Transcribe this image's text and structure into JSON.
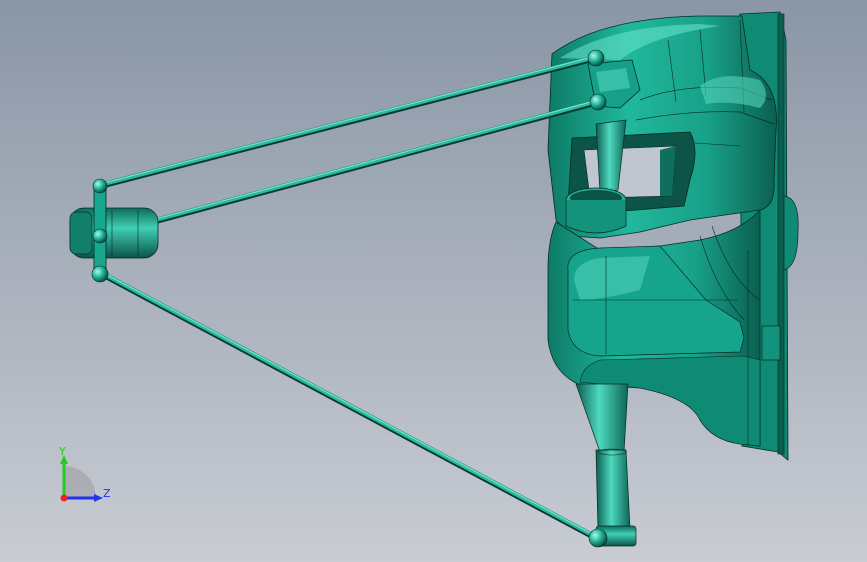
{
  "viewport": {
    "bg_top": "#8a96a6",
    "bg_bottom": "#c9ccd3"
  },
  "model": {
    "body_color": "#1aa68e",
    "body_dark": "#0c6b5a",
    "body_light": "#5fe0c8",
    "edge_color": "#052b24",
    "rod_color": "#2bb9a0"
  },
  "triad": {
    "y_label": "Y",
    "z_label": "Z",
    "y_color": "#22cc22",
    "z_color": "#2233ee",
    "x_color": "#ee2222",
    "arc_color": "#a8a8b0"
  }
}
